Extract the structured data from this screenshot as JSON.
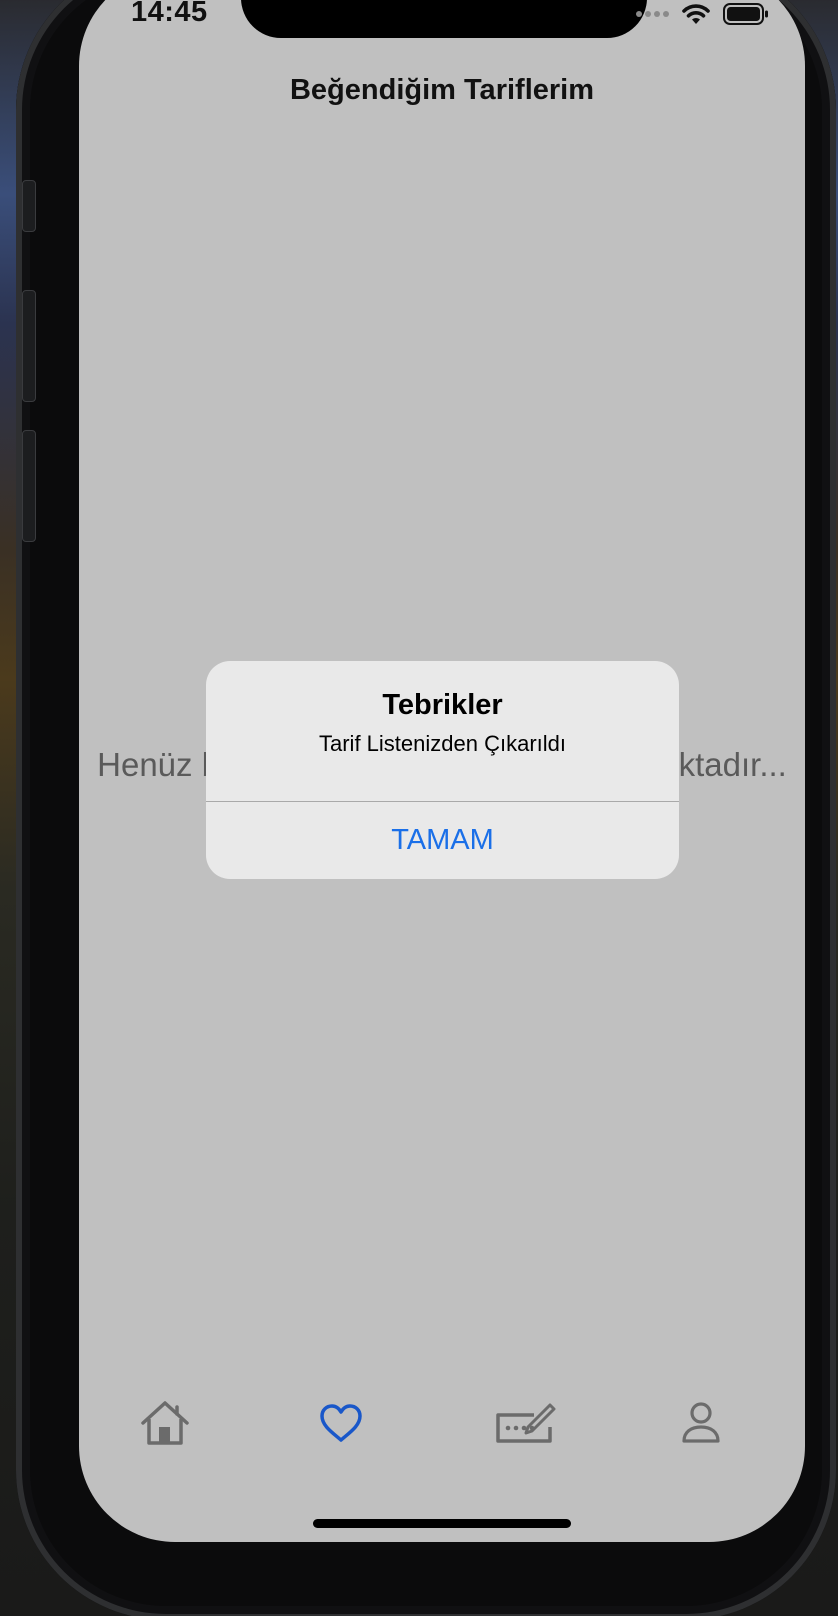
{
  "status_bar": {
    "time": "14:45"
  },
  "header": {
    "title": "Beğendiğim Tariflerim"
  },
  "main": {
    "empty_message": "Henüz beğendiğiniz bir tarif bulunmamaktadır..."
  },
  "alert": {
    "title": "Tebrikler",
    "message": "Tarif Listenizden Çıkarıldı",
    "button_label": "TAMAM"
  },
  "tab_bar": {
    "items": [
      {
        "icon": "home-icon",
        "active": false
      },
      {
        "icon": "heart-icon",
        "active": true
      },
      {
        "icon": "keyboard-edit-icon",
        "active": false
      },
      {
        "icon": "person-icon",
        "active": false
      }
    ]
  },
  "colors": {
    "screen_background": "#c0c0c0",
    "alert_background": "#e9e9e9",
    "accent": "#1a6fe8",
    "tab_inactive": "#6b6b6b",
    "tab_active": "#1957c9"
  }
}
